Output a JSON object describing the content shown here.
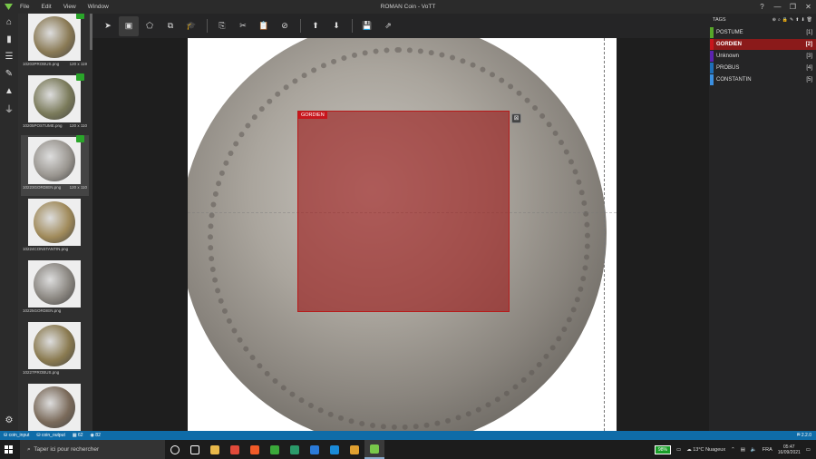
{
  "window": {
    "title": "ROMAN Coin - VoTT",
    "menus": [
      "File",
      "Edit",
      "View",
      "Window"
    ],
    "controls": {
      "help": "?",
      "minimize": "—",
      "maximize": "❐",
      "close": "✕"
    }
  },
  "leftnav": {
    "items": [
      "home-icon",
      "bookmark-icon",
      "sliders-icon",
      "edit-icon",
      "graduation-icon",
      "plug-icon"
    ],
    "settings": "gear-icon"
  },
  "thumbnails": [
    {
      "name": "10203PROBUS.png",
      "size": "120 x 119",
      "tagged": true,
      "active": false,
      "color": "#8a7a55"
    },
    {
      "name": "10205POSTUME.png",
      "size": "120 x 110",
      "tagged": true,
      "active": false,
      "color": "#7a7a5a"
    },
    {
      "name": "10223GORDIEN.png",
      "size": "120 x 110",
      "tagged": true,
      "active": true,
      "color": "#9a9690"
    },
    {
      "name": "10224CONSTANTIN.png",
      "size": "",
      "tagged": false,
      "active": false,
      "color": "#a08a5a"
    },
    {
      "name": "10225GORDIEN.png",
      "size": "",
      "tagged": false,
      "active": false,
      "color": "#8a8680"
    },
    {
      "name": "10227PROBUS.png",
      "size": "",
      "tagged": false,
      "active": false,
      "color": "#8a7a50"
    },
    {
      "name": "",
      "size": "",
      "tagged": false,
      "active": false,
      "color": "#7a6a5a"
    }
  ],
  "toolbar": {
    "groups": [
      [
        "pointer-icon",
        "rectangle-icon",
        "polygon-icon",
        "copy-rect-icon",
        "learn-icon"
      ],
      [
        "copy-icon",
        "cut-icon",
        "paste-icon",
        "clear-icon"
      ],
      [
        "prev-asset-icon",
        "next-asset-icon"
      ],
      [
        "save-icon",
        "export-icon"
      ]
    ],
    "glyphs": {
      "pointer-icon": "➤",
      "rectangle-icon": "▣",
      "polygon-icon": "⬠",
      "copy-rect-icon": "⧉",
      "learn-icon": "🎓",
      "copy-icon": "⎘",
      "cut-icon": "✂",
      "paste-icon": "📋",
      "clear-icon": "⊘",
      "prev-asset-icon": "⬆",
      "next-asset-icon": "⬇",
      "save-icon": "💾",
      "export-icon": "⇗"
    },
    "selected": "rectangle-icon"
  },
  "region": {
    "label": "GORDIEN",
    "color": "#c8161d"
  },
  "tags": {
    "header": "TAGS",
    "items": [
      {
        "name": "POSTUME",
        "hotkey": "[1]",
        "color": "#57a62a",
        "selected": false
      },
      {
        "name": "GORDIEN",
        "hotkey": "[2]",
        "color": "#c8161d",
        "selected": true
      },
      {
        "name": "Unknown",
        "hotkey": "[3]",
        "color": "#5b23b0",
        "selected": false
      },
      {
        "name": "PROBUS",
        "hotkey": "[4]",
        "color": "#1f6fb8",
        "selected": false
      },
      {
        "name": "CONSTANTIN",
        "hotkey": "[5]",
        "color": "#3a8fe0",
        "selected": false
      }
    ]
  },
  "status": {
    "source": "coin_input",
    "target": "coin_output",
    "tagged": "62",
    "visited": "82",
    "version": "2.2.0"
  },
  "taskbar": {
    "search_placeholder": "Taper ici pour rechercher",
    "apps": [
      {
        "name": "explorer",
        "color": "#e8b84a"
      },
      {
        "name": "chrome",
        "color": "#e04a3a"
      },
      {
        "name": "brave",
        "color": "#f05a28"
      },
      {
        "name": "xbox",
        "color": "#3aa83a"
      },
      {
        "name": "app-circle",
        "color": "#2a9a6a"
      },
      {
        "name": "vscode",
        "color": "#2a7ad8"
      },
      {
        "name": "app-s",
        "color": "#1a8ad8"
      },
      {
        "name": "chrome-2",
        "color": "#e0a030"
      },
      {
        "name": "vott",
        "color": "#78c84a"
      }
    ],
    "battery": "98%",
    "weather": "13°C",
    "weather_desc": "Nuageux",
    "lang": "FRA",
    "time": "05:47",
    "date": "16/09/2021"
  }
}
